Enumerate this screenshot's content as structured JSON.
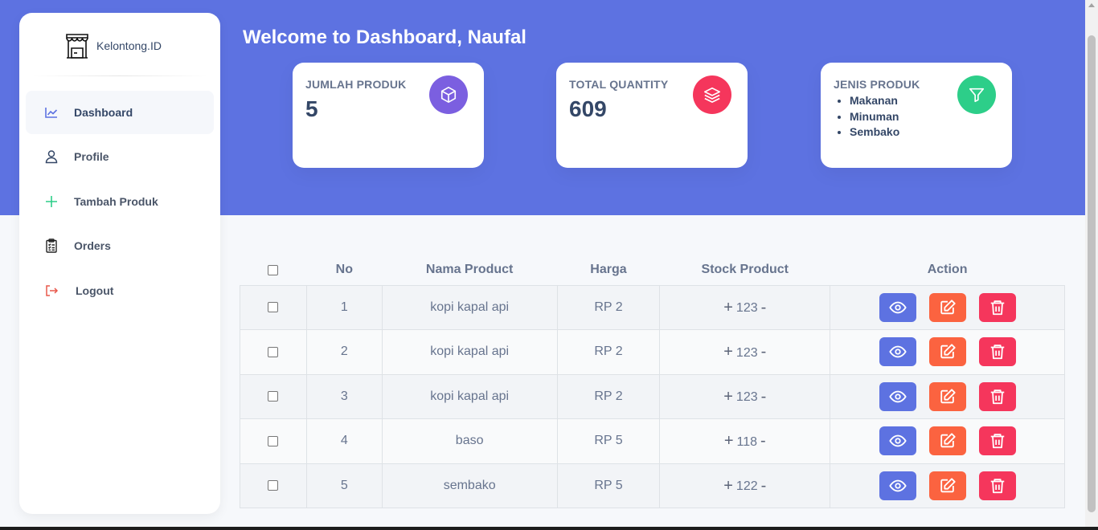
{
  "brand": {
    "name": "Kelontong.ID"
  },
  "sidebar": {
    "items": [
      {
        "label": "Dashboard",
        "icon": "chart-line-icon"
      },
      {
        "label": "Profile",
        "icon": "user-icon"
      },
      {
        "label": "Tambah Produk",
        "icon": "plus-icon"
      },
      {
        "label": "Orders",
        "icon": "clipboard-list-icon"
      },
      {
        "label": "Logout",
        "icon": "logout-icon"
      }
    ]
  },
  "header": {
    "welcome": "Welcome to Dashboard, Naufal"
  },
  "cards": {
    "jumlah": {
      "label": "JUMLAH PRODUK",
      "value": "5",
      "icon": "cube-icon",
      "color": "#7b5fe0"
    },
    "quantity": {
      "label": "TOTAL QUANTITY",
      "value": "609",
      "icon": "layers-icon",
      "color": "#f5365c"
    },
    "jenis": {
      "label": "JENIS PRODUK",
      "items": [
        "Makanan",
        "Minuman",
        "Sembako"
      ],
      "icon": "filter-icon",
      "color": "#2dce89"
    }
  },
  "table": {
    "headers": {
      "no": "No",
      "nama": "Nama Product",
      "harga": "Harga",
      "stock": "Stock Product",
      "action": "Action"
    },
    "rows": [
      {
        "no": "1",
        "nama": "kopi kapal api",
        "harga": "RP 2",
        "stock": "123"
      },
      {
        "no": "2",
        "nama": "kopi kapal api",
        "harga": "RP 2",
        "stock": "123"
      },
      {
        "no": "3",
        "nama": "kopi kapal api",
        "harga": "RP 2",
        "stock": "123"
      },
      {
        "no": "4",
        "nama": "baso",
        "harga": "RP 5",
        "stock": "118"
      },
      {
        "no": "5",
        "nama": "sembako",
        "harga": "RP 5",
        "stock": "122"
      }
    ],
    "plus": "+",
    "minus": "-"
  },
  "colors": {
    "primary": "#5d72e1",
    "edit": "#fb6340",
    "delete": "#f5365c",
    "success": "#2dce89"
  }
}
